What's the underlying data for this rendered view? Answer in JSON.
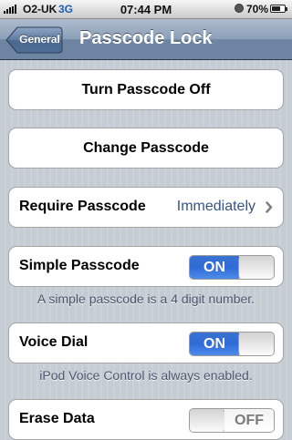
{
  "status_bar": {
    "carrier": "O2-UK",
    "network": "3G",
    "time": "07:44 PM",
    "battery": "70%",
    "battery_level": 0.7,
    "lock_icon": "rotation-lock-icon"
  },
  "nav": {
    "back_label": "General",
    "title": "Passcode Lock"
  },
  "rows": {
    "turn_off": "Turn Passcode Off",
    "change": "Change Passcode",
    "require": {
      "label": "Require Passcode",
      "value": "Immediately"
    },
    "simple": {
      "label": "Simple Passcode",
      "state": "ON",
      "on": true
    },
    "simple_note": "A simple passcode is a 4 digit number.",
    "voice": {
      "label": "Voice Dial",
      "state": "ON",
      "on": true
    },
    "voice_note": "iPod Voice Control is always enabled.",
    "erase": {
      "label": "Erase Data",
      "state": "OFF",
      "on": false
    }
  },
  "colors": {
    "toggle_on": "#2f6bd7",
    "value_blue": "#385487",
    "navbar": "#6d84a2",
    "background": "#c5ccd4"
  }
}
